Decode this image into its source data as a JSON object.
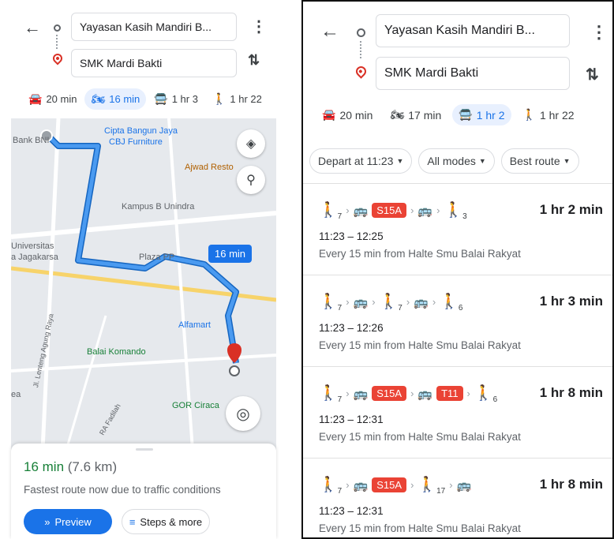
{
  "left_panel": {
    "origin": "Yayasan Kasih Mandiri B...",
    "destination": "SMK Mardi Bakti",
    "modes": [
      {
        "icon": "car-icon",
        "label": "20 min"
      },
      {
        "icon": "motorcycle-icon",
        "label": "16 min"
      },
      {
        "icon": "transit-icon",
        "label": "1 hr 3"
      },
      {
        "icon": "walk-icon",
        "label": "1 hr 22"
      }
    ],
    "map": {
      "labels": {
        "bank": "Bank BNI",
        "cipta": "Cipta Bangun Jaya",
        "cbj": "CBJ Furniture",
        "ajwad": "Ajwad Resto",
        "kampus": "Kampus B Unindra",
        "universitas": "Universitas",
        "jagakarsa": "a Jagakarsa",
        "plaza": "Plaza PP",
        "alfamart": "Alfamart",
        "balai": "Balai Komando",
        "lenteng": "Jl. Lenteng Agung Raya",
        "gor": "GOR Ciraca",
        "fadilah": "RA Fadilah",
        "ea": "ea"
      },
      "time_chip": "16 min"
    },
    "sheet": {
      "duration": "16 min",
      "distance": "(7.6 km)",
      "subtitle": "Fastest route now due to traffic conditions",
      "preview_label": "Preview",
      "steps_label": "Steps & more"
    }
  },
  "right_panel": {
    "origin": "Yayasan Kasih Mandiri B...",
    "destination": "SMK Mardi Bakti",
    "modes": [
      {
        "icon": "car-icon",
        "label": "20 min"
      },
      {
        "icon": "motorcycle-icon",
        "label": "17 min"
      },
      {
        "icon": "transit-icon",
        "label": "1 hr 2"
      },
      {
        "icon": "walk-icon",
        "label": "1 hr 22"
      }
    ],
    "filters": [
      "Depart at 11:23",
      "All modes",
      "Best route"
    ],
    "routes": [
      {
        "walk_a": "7",
        "badge_a": "S15A",
        "walk_end": "3",
        "duration": "1 hr 2 min",
        "time": "11:23 – 12:25",
        "frequency": "Every 15 min from Halte Smu Balai Rakyat"
      },
      {
        "walk_a": "7",
        "walk_b": "7",
        "walk_end": "6",
        "duration": "1 hr 3 min",
        "time": "11:23 – 12:26",
        "frequency": "Every 15 min from Halte Smu Balai Rakyat"
      },
      {
        "walk_a": "7",
        "badge_a": "S15A",
        "badge_b": "T11",
        "walk_end": "6",
        "duration": "1 hr 8 min",
        "time": "11:23 – 12:31",
        "frequency": "Every 15 min from Halte Smu Balai Rakyat"
      },
      {
        "walk_a": "7",
        "badge_a": "S15A",
        "walk_b": "17",
        "duration": "1 hr 8 min",
        "time": "11:23 – 12:31",
        "frequency": "Every 15 min from Halte Smu Balai Rakyat"
      }
    ]
  },
  "colors": {
    "accent": "#1a73e8",
    "route_line": "#4a9af0",
    "green": "#188038",
    "badge_red": "#ea4335",
    "pin_red": "#d93025"
  }
}
